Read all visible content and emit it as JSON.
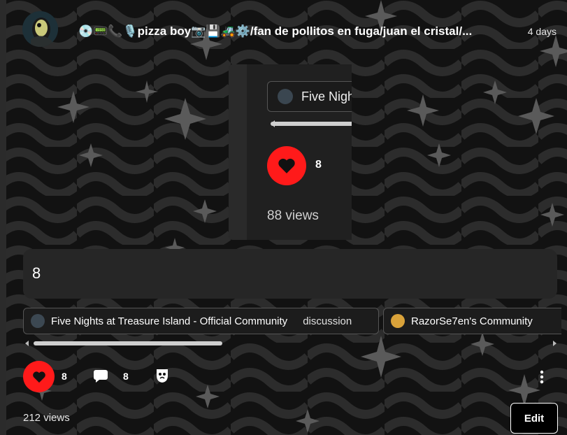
{
  "post": {
    "author_title": "💿📟📞🎙️pizza boy📷💾🚜⚙️/fan de pollitos en fuga/juan el cristal/...",
    "timestamp": "4 days",
    "body_text": "8",
    "views": "212 views",
    "like_count": "8",
    "comment_count": "8"
  },
  "embedded_screenshot": {
    "chip_text": "Five Nigh",
    "like_count": "8",
    "views": "88 views"
  },
  "communities": [
    {
      "name": "Five Nights at Treasure Island - Official Community",
      "category": "discussion"
    },
    {
      "name": "RazorSe7en's Community",
      "category": ""
    }
  ],
  "actions": {
    "edit_label": "Edit"
  },
  "icons": {
    "like": "heart-icon",
    "comment": "comment-icon",
    "mask": "mask-icon",
    "more": "more-vertical-icon"
  },
  "colors": {
    "accent_red": "#ff1a1a",
    "background": "#121212"
  }
}
